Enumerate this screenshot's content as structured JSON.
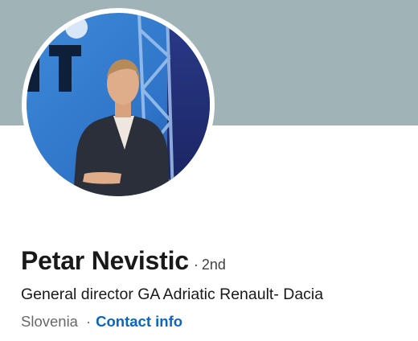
{
  "profile": {
    "name": "Petar Nevistic",
    "degree_separator": "·",
    "degree": "2nd",
    "headline": "General director GA Adriatic Renault- Dacia",
    "location": "Slovenia",
    "meta_separator": "·",
    "contact_info_label": "Contact info"
  },
  "colors": {
    "cover": "#a0b4b7",
    "link": "#0a66c2"
  },
  "icons": {
    "avatar": "profile-photo"
  }
}
